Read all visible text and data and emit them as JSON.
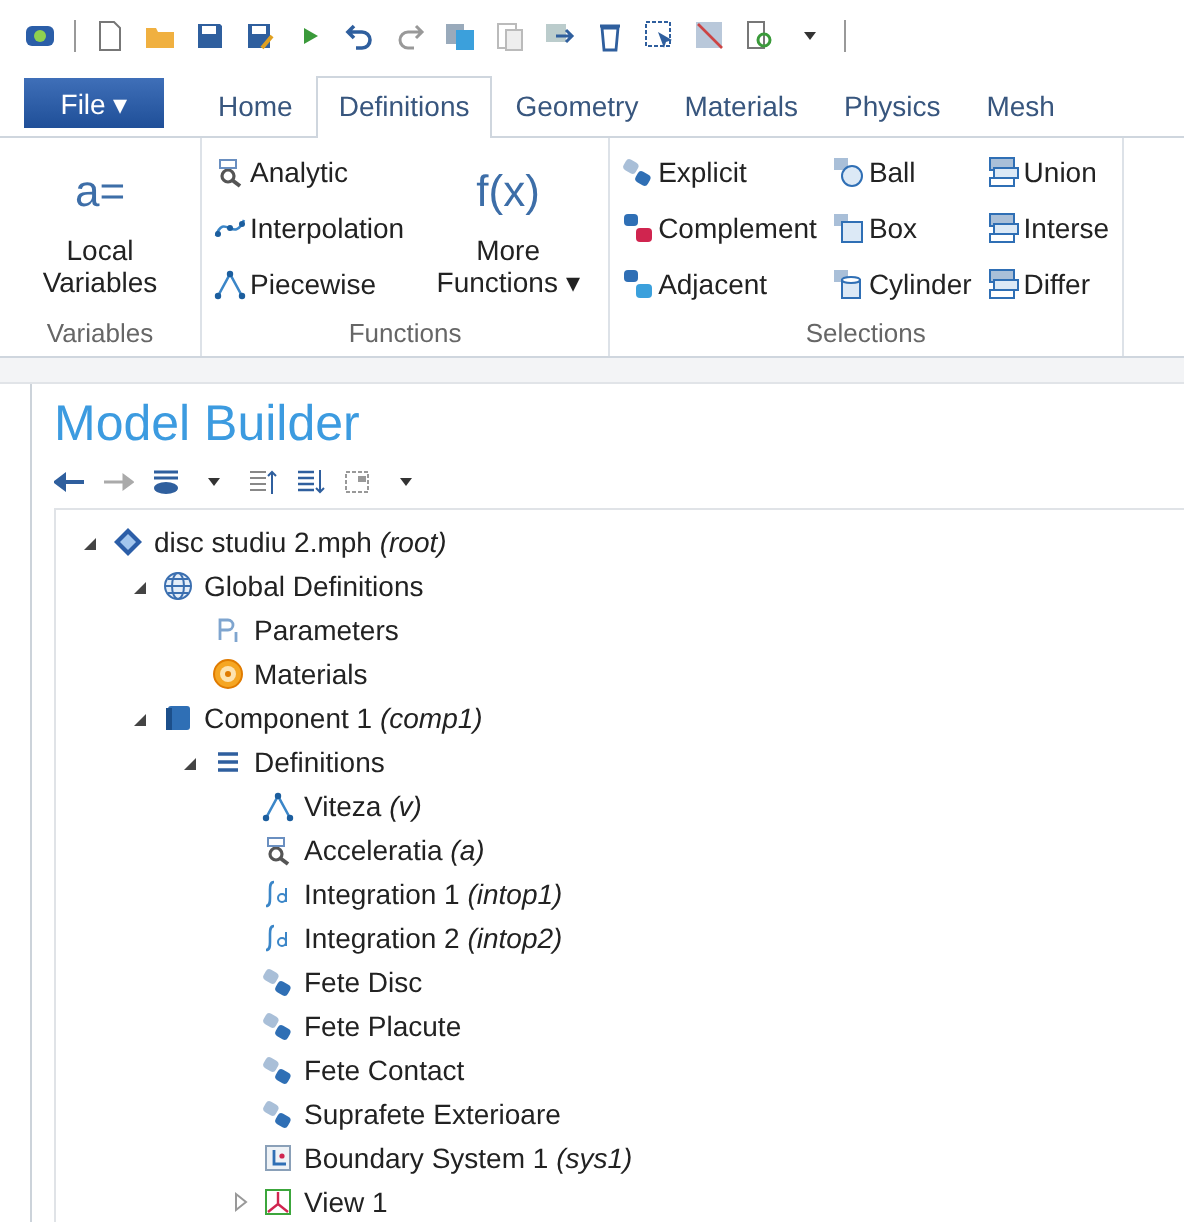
{
  "tabs": [
    {
      "label": "File ▾",
      "kind": "file"
    },
    {
      "label": "Home",
      "kind": "tab",
      "selected": false
    },
    {
      "label": "Definitions",
      "kind": "tab",
      "selected": true
    },
    {
      "label": "Geometry",
      "kind": "tab",
      "selected": false
    },
    {
      "label": "Materials",
      "kind": "tab",
      "selected": false
    },
    {
      "label": "Physics",
      "kind": "tab",
      "selected": false
    },
    {
      "label": "Mesh",
      "kind": "tab",
      "selected": false
    }
  ],
  "ribbon": {
    "groups": [
      {
        "label": "Variables",
        "columns": [
          [
            {
              "kind": "large",
              "glyph": "a=",
              "label": "Local Variables"
            }
          ]
        ]
      },
      {
        "label": "Functions",
        "columns": [
          [
            {
              "kind": "analytic",
              "label": "Analytic"
            },
            {
              "kind": "interpolation",
              "label": "Interpolation"
            },
            {
              "kind": "piecewise",
              "label": "Piecewise"
            }
          ],
          [
            {
              "kind": "large",
              "glyph": "f(x)",
              "label": "More Functions ▾"
            }
          ]
        ]
      },
      {
        "label": "Selections",
        "columns": [
          [
            {
              "kind": "explicit",
              "label": "Explicit"
            },
            {
              "kind": "complement",
              "label": "Complement"
            },
            {
              "kind": "adjacent",
              "label": "Adjacent"
            }
          ],
          [
            {
              "kind": "ball",
              "label": "Ball"
            },
            {
              "kind": "box",
              "label": "Box"
            },
            {
              "kind": "cylinder",
              "label": "Cylinder"
            }
          ],
          [
            {
              "kind": "union",
              "label": "Union"
            },
            {
              "kind": "union",
              "label": "Interse"
            },
            {
              "kind": "union",
              "label": "Differ"
            }
          ]
        ]
      }
    ]
  },
  "model_builder": {
    "title": "Model Builder",
    "tree": [
      {
        "label": "disc studiu 2.mph",
        "tag": "(root)",
        "kind": "file",
        "expanded": true,
        "children": [
          {
            "label": "Global Definitions",
            "kind": "globe",
            "expanded": true,
            "children": [
              {
                "label": "Parameters",
                "kind": "parameters"
              },
              {
                "label": "Materials",
                "kind": "materials"
              }
            ]
          },
          {
            "label": "Component 1",
            "tag": "(comp1)",
            "kind": "component",
            "expanded": true,
            "children": [
              {
                "label": "Definitions",
                "kind": "definitions",
                "expanded": true,
                "children": [
                  {
                    "label": "Viteza",
                    "tag": "(v)",
                    "kind": "piecewise"
                  },
                  {
                    "label": "Acceleratia",
                    "tag": "(a)",
                    "kind": "analytic"
                  },
                  {
                    "label": "Integration 1",
                    "tag": "(intop1)",
                    "kind": "integration"
                  },
                  {
                    "label": "Integration 2",
                    "tag": "(intop2)",
                    "kind": "integration"
                  },
                  {
                    "label": "Fete Disc",
                    "kind": "selection"
                  },
                  {
                    "label": "Fete Placute",
                    "kind": "selection"
                  },
                  {
                    "label": "Fete Contact",
                    "kind": "selection"
                  },
                  {
                    "label": "Suprafete Exterioare",
                    "kind": "selection"
                  },
                  {
                    "label": "Boundary System 1",
                    "tag": "(sys1)",
                    "kind": "coordinate-system"
                  },
                  {
                    "label": "View 1",
                    "kind": "view",
                    "expanded": false
                  }
                ]
              }
            ]
          }
        ]
      }
    ]
  }
}
